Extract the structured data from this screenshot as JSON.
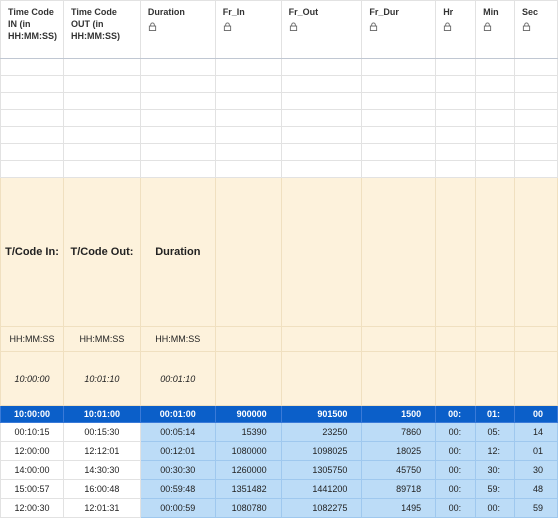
{
  "headers": [
    {
      "label": "Time Code IN (in HH:MM:SS)",
      "locked": false
    },
    {
      "label": "Time Code OUT (in HH:MM:SS)",
      "locked": false
    },
    {
      "label": "Duration",
      "locked": true
    },
    {
      "label": "Fr_In",
      "locked": true
    },
    {
      "label": "Fr_Out",
      "locked": true
    },
    {
      "label": "Fr_Dur",
      "locked": true
    },
    {
      "label": "Hr",
      "locked": true
    },
    {
      "label": "Min",
      "locked": true
    },
    {
      "label": "Sec",
      "locked": true
    }
  ],
  "instructions": {
    "titles": [
      "T/Code In:",
      "T/Code Out:",
      "Duration"
    ],
    "formats": [
      "HH:MM:SS",
      "HH:MM:SS",
      "HH:MM:SS"
    ],
    "examples": [
      "10:00:00",
      "10:01:10",
      "00:01:10"
    ]
  },
  "rows": [
    [
      "10:00:00",
      "10:01:00",
      "00:01:00",
      "900000",
      "901500",
      "1500",
      "00:",
      "01:",
      "00"
    ],
    [
      "00:10:15",
      "00:15:30",
      "00:05:14",
      "15390",
      "23250",
      "7860",
      "00:",
      "05:",
      "14"
    ],
    [
      "12:00:00",
      "12:12:01",
      "00:12:01",
      "1080000",
      "1098025",
      "18025",
      "00:",
      "12:",
      "01"
    ],
    [
      "14:00:00",
      "14:30:30",
      "00:30:30",
      "1260000",
      "1305750",
      "45750",
      "00:",
      "30:",
      "30"
    ],
    [
      "15:00:57",
      "16:00:48",
      "00:59:48",
      "1351482",
      "1441200",
      "89718",
      "00:",
      "59:",
      "48"
    ],
    [
      "12:00:30",
      "12:01:31",
      "00:00:59",
      "1080780",
      "1082275",
      "1495",
      "00:",
      "00:",
      "59"
    ]
  ],
  "colors": {
    "selected_row": "#0b5fc9",
    "highlight": "#bcdcf7",
    "instruction_bg": "#fdf2dc"
  },
  "icons": {
    "locked": "lock-icon"
  }
}
